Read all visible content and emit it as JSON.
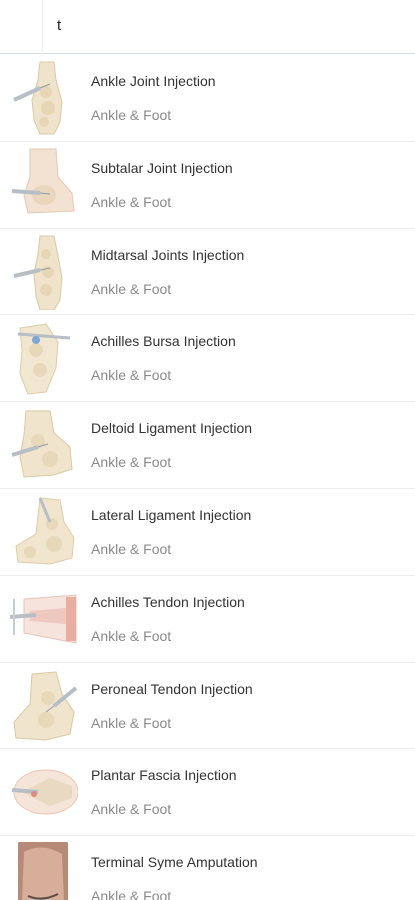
{
  "search": {
    "query": "t"
  },
  "items": [
    {
      "title": "Ankle Joint Injection",
      "category": "Ankle & Foot",
      "icon": "ankle-foot-illustration-icon"
    },
    {
      "title": "Subtalar Joint Injection",
      "category": "Ankle & Foot",
      "icon": "ankle-foot-illustration-icon"
    },
    {
      "title": "Midtarsal Joints Injection",
      "category": "Ankle & Foot",
      "icon": "ankle-foot-illustration-icon"
    },
    {
      "title": "Achilles Bursa Injection",
      "category": "Ankle & Foot",
      "icon": "ankle-foot-illustration-icon"
    },
    {
      "title": "Deltoid Ligament Injection",
      "category": "Ankle & Foot",
      "icon": "ankle-foot-illustration-icon"
    },
    {
      "title": "Lateral Ligament Injection",
      "category": "Ankle & Foot",
      "icon": "ankle-foot-illustration-icon"
    },
    {
      "title": "Achilles Tendon Injection",
      "category": "Ankle & Foot",
      "icon": "ankle-foot-illustration-icon"
    },
    {
      "title": "Peroneal Tendon Injection",
      "category": "Ankle & Foot",
      "icon": "ankle-foot-illustration-icon"
    },
    {
      "title": "Plantar Fascia Injection",
      "category": "Ankle & Foot",
      "icon": "ankle-foot-illustration-icon"
    },
    {
      "title": "Terminal Syme Amputation",
      "category": "Ankle & Foot",
      "icon": "foot-photo-thumbnail"
    }
  ],
  "colors": {
    "bone": "#e9dcc0",
    "skin": "#f2e4d2",
    "syringe": "#c8ccd2",
    "divider": "#eef0f3"
  }
}
